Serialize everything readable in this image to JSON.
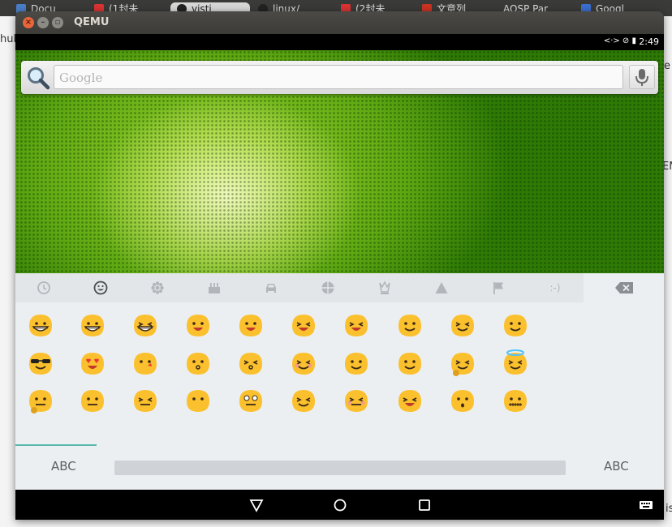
{
  "background_browser": {
    "tabs": [
      "Docu",
      "(1封未",
      "visti",
      "linux/",
      "(2封未",
      "文章列",
      "AOSP Par",
      "Googl"
    ],
    "page_fragments": [
      "hub",
      "e",
      "EM",
      "is"
    ]
  },
  "window": {
    "title": "QEMU"
  },
  "status_bar": {
    "time": "2:49",
    "icons": "<·> ⊘ ▮"
  },
  "search": {
    "placeholder": "Google"
  },
  "keyboard": {
    "categories": [
      "recent-icon",
      "smiley-icon",
      "flower-icon",
      "cake-icon",
      "car-icon",
      "globe-icon",
      "chess-icon",
      "triangle-icon",
      "flag-icon",
      ":-)"
    ],
    "selected_category": "smiley-icon",
    "left_label": "ABC",
    "right_label": "ABC"
  },
  "colors": {
    "accent": "#57b8ab",
    "emoji": "#fbc02d",
    "nav_bar": "#000000"
  }
}
